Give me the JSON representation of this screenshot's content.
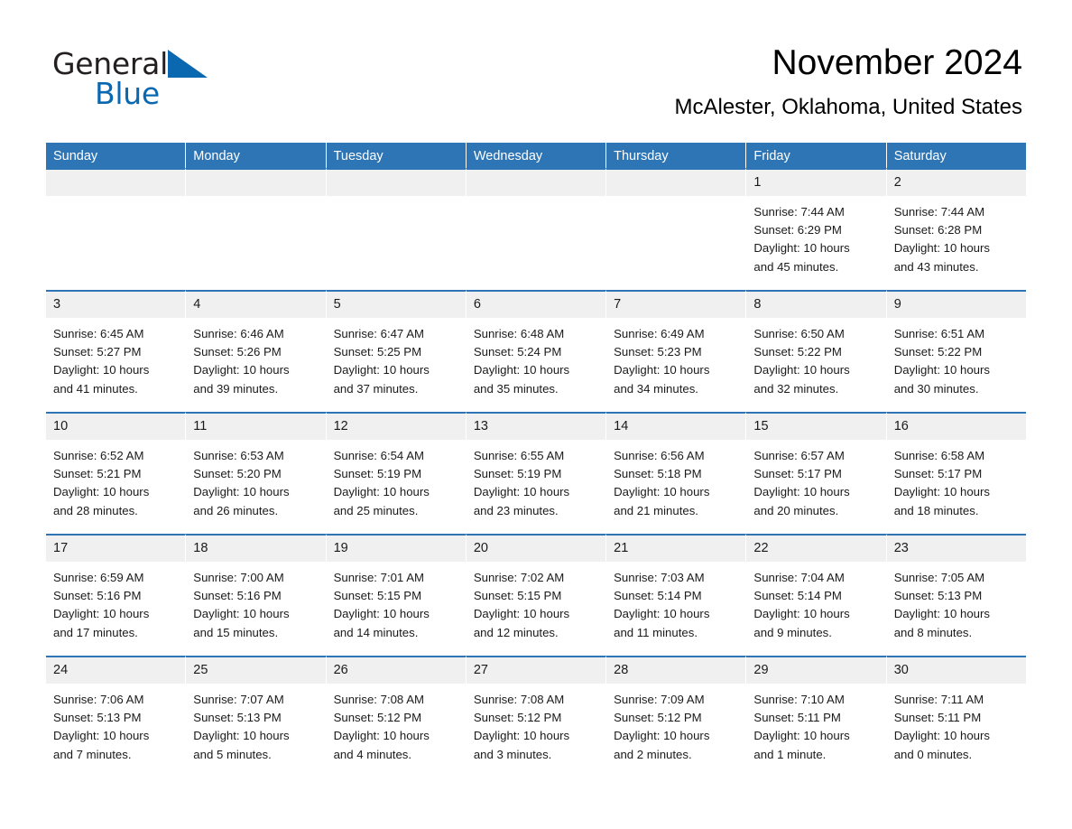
{
  "brand": {
    "name_part1": "General",
    "name_part2": "Blue",
    "accent_color": "#0a68b0",
    "triangle_icon": "triangle-icon"
  },
  "header": {
    "month_title": "November 2024",
    "location": "McAlester, Oklahoma, United States"
  },
  "theme": {
    "header_blue": "#2e75b6",
    "day_band_grey": "#f0f0f0",
    "text": "#1a1a1a"
  },
  "weekdays": [
    "Sunday",
    "Monday",
    "Tuesday",
    "Wednesday",
    "Thursday",
    "Friday",
    "Saturday"
  ],
  "labels": {
    "sunrise_prefix": "Sunrise:",
    "sunset_prefix": "Sunset:",
    "daylight_prefix": "Daylight:"
  },
  "weeks": [
    [
      {
        "day": "",
        "empty": true
      },
      {
        "day": "",
        "empty": true
      },
      {
        "day": "",
        "empty": true
      },
      {
        "day": "",
        "empty": true
      },
      {
        "day": "",
        "empty": true
      },
      {
        "day": "1",
        "sunrise": "Sunrise: 7:44 AM",
        "sunset": "Sunset: 6:29 PM",
        "daylight_line1": "Daylight: 10 hours",
        "daylight_line2": "and 45 minutes."
      },
      {
        "day": "2",
        "sunrise": "Sunrise: 7:44 AM",
        "sunset": "Sunset: 6:28 PM",
        "daylight_line1": "Daylight: 10 hours",
        "daylight_line2": "and 43 minutes."
      }
    ],
    [
      {
        "day": "3",
        "sunrise": "Sunrise: 6:45 AM",
        "sunset": "Sunset: 5:27 PM",
        "daylight_line1": "Daylight: 10 hours",
        "daylight_line2": "and 41 minutes."
      },
      {
        "day": "4",
        "sunrise": "Sunrise: 6:46 AM",
        "sunset": "Sunset: 5:26 PM",
        "daylight_line1": "Daylight: 10 hours",
        "daylight_line2": "and 39 minutes."
      },
      {
        "day": "5",
        "sunrise": "Sunrise: 6:47 AM",
        "sunset": "Sunset: 5:25 PM",
        "daylight_line1": "Daylight: 10 hours",
        "daylight_line2": "and 37 minutes."
      },
      {
        "day": "6",
        "sunrise": "Sunrise: 6:48 AM",
        "sunset": "Sunset: 5:24 PM",
        "daylight_line1": "Daylight: 10 hours",
        "daylight_line2": "and 35 minutes."
      },
      {
        "day": "7",
        "sunrise": "Sunrise: 6:49 AM",
        "sunset": "Sunset: 5:23 PM",
        "daylight_line1": "Daylight: 10 hours",
        "daylight_line2": "and 34 minutes."
      },
      {
        "day": "8",
        "sunrise": "Sunrise: 6:50 AM",
        "sunset": "Sunset: 5:22 PM",
        "daylight_line1": "Daylight: 10 hours",
        "daylight_line2": "and 32 minutes."
      },
      {
        "day": "9",
        "sunrise": "Sunrise: 6:51 AM",
        "sunset": "Sunset: 5:22 PM",
        "daylight_line1": "Daylight: 10 hours",
        "daylight_line2": "and 30 minutes."
      }
    ],
    [
      {
        "day": "10",
        "sunrise": "Sunrise: 6:52 AM",
        "sunset": "Sunset: 5:21 PM",
        "daylight_line1": "Daylight: 10 hours",
        "daylight_line2": "and 28 minutes."
      },
      {
        "day": "11",
        "sunrise": "Sunrise: 6:53 AM",
        "sunset": "Sunset: 5:20 PM",
        "daylight_line1": "Daylight: 10 hours",
        "daylight_line2": "and 26 minutes."
      },
      {
        "day": "12",
        "sunrise": "Sunrise: 6:54 AM",
        "sunset": "Sunset: 5:19 PM",
        "daylight_line1": "Daylight: 10 hours",
        "daylight_line2": "and 25 minutes."
      },
      {
        "day": "13",
        "sunrise": "Sunrise: 6:55 AM",
        "sunset": "Sunset: 5:19 PM",
        "daylight_line1": "Daylight: 10 hours",
        "daylight_line2": "and 23 minutes."
      },
      {
        "day": "14",
        "sunrise": "Sunrise: 6:56 AM",
        "sunset": "Sunset: 5:18 PM",
        "daylight_line1": "Daylight: 10 hours",
        "daylight_line2": "and 21 minutes."
      },
      {
        "day": "15",
        "sunrise": "Sunrise: 6:57 AM",
        "sunset": "Sunset: 5:17 PM",
        "daylight_line1": "Daylight: 10 hours",
        "daylight_line2": "and 20 minutes."
      },
      {
        "day": "16",
        "sunrise": "Sunrise: 6:58 AM",
        "sunset": "Sunset: 5:17 PM",
        "daylight_line1": "Daylight: 10 hours",
        "daylight_line2": "and 18 minutes."
      }
    ],
    [
      {
        "day": "17",
        "sunrise": "Sunrise: 6:59 AM",
        "sunset": "Sunset: 5:16 PM",
        "daylight_line1": "Daylight: 10 hours",
        "daylight_line2": "and 17 minutes."
      },
      {
        "day": "18",
        "sunrise": "Sunrise: 7:00 AM",
        "sunset": "Sunset: 5:16 PM",
        "daylight_line1": "Daylight: 10 hours",
        "daylight_line2": "and 15 minutes."
      },
      {
        "day": "19",
        "sunrise": "Sunrise: 7:01 AM",
        "sunset": "Sunset: 5:15 PM",
        "daylight_line1": "Daylight: 10 hours",
        "daylight_line2": "and 14 minutes."
      },
      {
        "day": "20",
        "sunrise": "Sunrise: 7:02 AM",
        "sunset": "Sunset: 5:15 PM",
        "daylight_line1": "Daylight: 10 hours",
        "daylight_line2": "and 12 minutes."
      },
      {
        "day": "21",
        "sunrise": "Sunrise: 7:03 AM",
        "sunset": "Sunset: 5:14 PM",
        "daylight_line1": "Daylight: 10 hours",
        "daylight_line2": "and 11 minutes."
      },
      {
        "day": "22",
        "sunrise": "Sunrise: 7:04 AM",
        "sunset": "Sunset: 5:14 PM",
        "daylight_line1": "Daylight: 10 hours",
        "daylight_line2": "and 9 minutes."
      },
      {
        "day": "23",
        "sunrise": "Sunrise: 7:05 AM",
        "sunset": "Sunset: 5:13 PM",
        "daylight_line1": "Daylight: 10 hours",
        "daylight_line2": "and 8 minutes."
      }
    ],
    [
      {
        "day": "24",
        "sunrise": "Sunrise: 7:06 AM",
        "sunset": "Sunset: 5:13 PM",
        "daylight_line1": "Daylight: 10 hours",
        "daylight_line2": "and 7 minutes."
      },
      {
        "day": "25",
        "sunrise": "Sunrise: 7:07 AM",
        "sunset": "Sunset: 5:13 PM",
        "daylight_line1": "Daylight: 10 hours",
        "daylight_line2": "and 5 minutes."
      },
      {
        "day": "26",
        "sunrise": "Sunrise: 7:08 AM",
        "sunset": "Sunset: 5:12 PM",
        "daylight_line1": "Daylight: 10 hours",
        "daylight_line2": "and 4 minutes."
      },
      {
        "day": "27",
        "sunrise": "Sunrise: 7:08 AM",
        "sunset": "Sunset: 5:12 PM",
        "daylight_line1": "Daylight: 10 hours",
        "daylight_line2": "and 3 minutes."
      },
      {
        "day": "28",
        "sunrise": "Sunrise: 7:09 AM",
        "sunset": "Sunset: 5:12 PM",
        "daylight_line1": "Daylight: 10 hours",
        "daylight_line2": "and 2 minutes."
      },
      {
        "day": "29",
        "sunrise": "Sunrise: 7:10 AM",
        "sunset": "Sunset: 5:11 PM",
        "daylight_line1": "Daylight: 10 hours",
        "daylight_line2": "and 1 minute."
      },
      {
        "day": "30",
        "sunrise": "Sunrise: 7:11 AM",
        "sunset": "Sunset: 5:11 PM",
        "daylight_line1": "Daylight: 10 hours",
        "daylight_line2": "and 0 minutes."
      }
    ]
  ]
}
